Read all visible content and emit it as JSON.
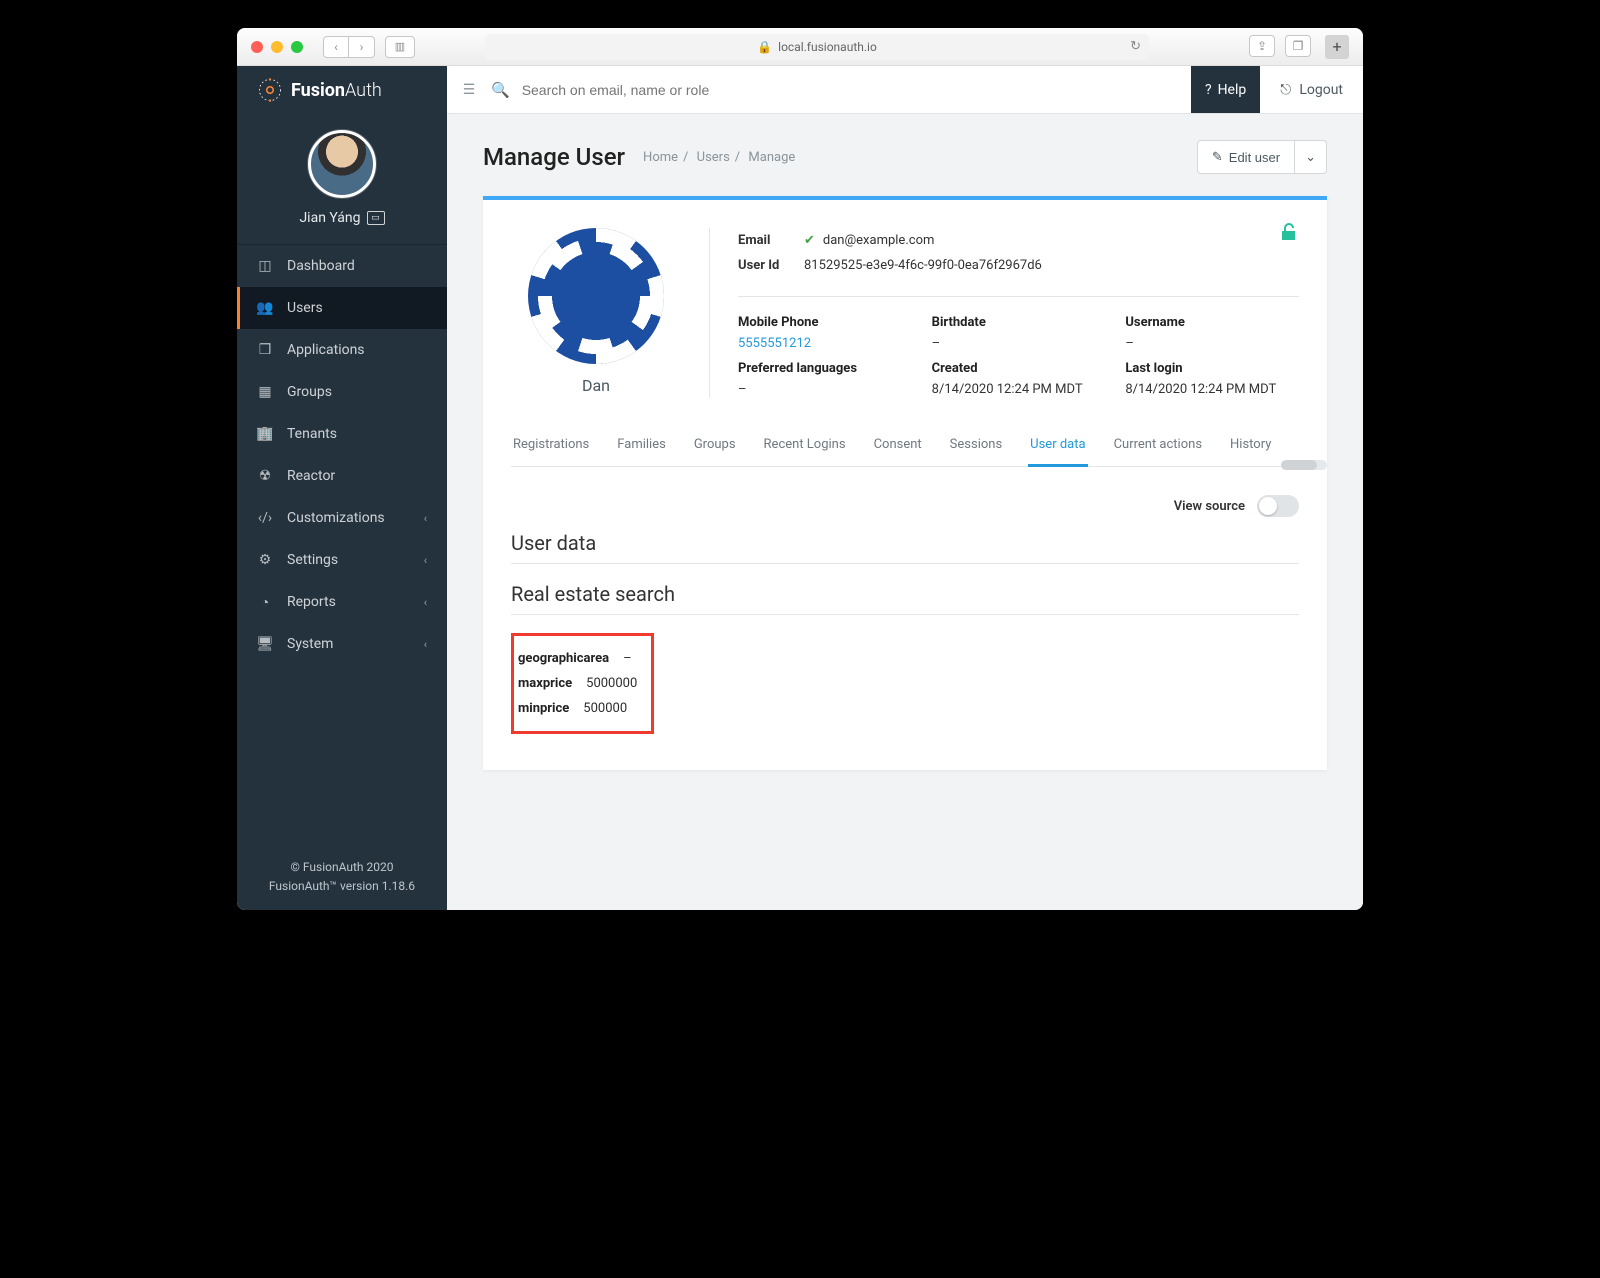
{
  "browser": {
    "url": "local.fusionauth.io"
  },
  "brand": {
    "name1": "Fusion",
    "name2": "Auth"
  },
  "profile": {
    "name": "Jian Yáng"
  },
  "nav": {
    "dashboard": "Dashboard",
    "users": "Users",
    "applications": "Applications",
    "groups": "Groups",
    "tenants": "Tenants",
    "reactor": "Reactor",
    "customizations": "Customizations",
    "settings": "Settings",
    "reports": "Reports",
    "system": "System"
  },
  "footer": {
    "line1": "© FusionAuth 2020",
    "line2": "FusionAuth™ version 1.18.6"
  },
  "topbar": {
    "search_placeholder": "Search on email, name or role",
    "help": "Help",
    "logout": "Logout"
  },
  "page": {
    "title": "Manage User",
    "crumbs": {
      "home": "Home",
      "users": "Users",
      "manage": "Manage"
    },
    "edit_label": "Edit user"
  },
  "user": {
    "display_name": "Dan",
    "email_label": "Email",
    "email": "dan@example.com",
    "userid_label": "User Id",
    "userid": "81529525-e3e9-4f6c-99f0-0ea76f2967d6",
    "mobile_label": "Mobile Phone",
    "mobile": "5555551212",
    "birthdate_label": "Birthdate",
    "birthdate": "–",
    "username_label": "Username",
    "username": "–",
    "preflang_label": "Preferred languages",
    "preflang": "–",
    "created_label": "Created",
    "created": "8/14/2020 12:24 PM MDT",
    "lastlogin_label": "Last login",
    "lastlogin": "8/14/2020 12:24 PM MDT"
  },
  "tabs": {
    "registrations": "Registrations",
    "families": "Families",
    "groups": "Groups",
    "recent_logins": "Recent Logins",
    "consent": "Consent",
    "sessions": "Sessions",
    "user_data": "User data",
    "current_actions": "Current actions",
    "history": "History"
  },
  "view_source_label": "View source",
  "userdata": {
    "heading": "User data",
    "section": "Real estate search",
    "rows": {
      "geographicarea": {
        "k": "geographicarea",
        "v": "–"
      },
      "maxprice": {
        "k": "maxprice",
        "v": "5000000"
      },
      "minprice": {
        "k": "minprice",
        "v": "500000"
      }
    }
  }
}
